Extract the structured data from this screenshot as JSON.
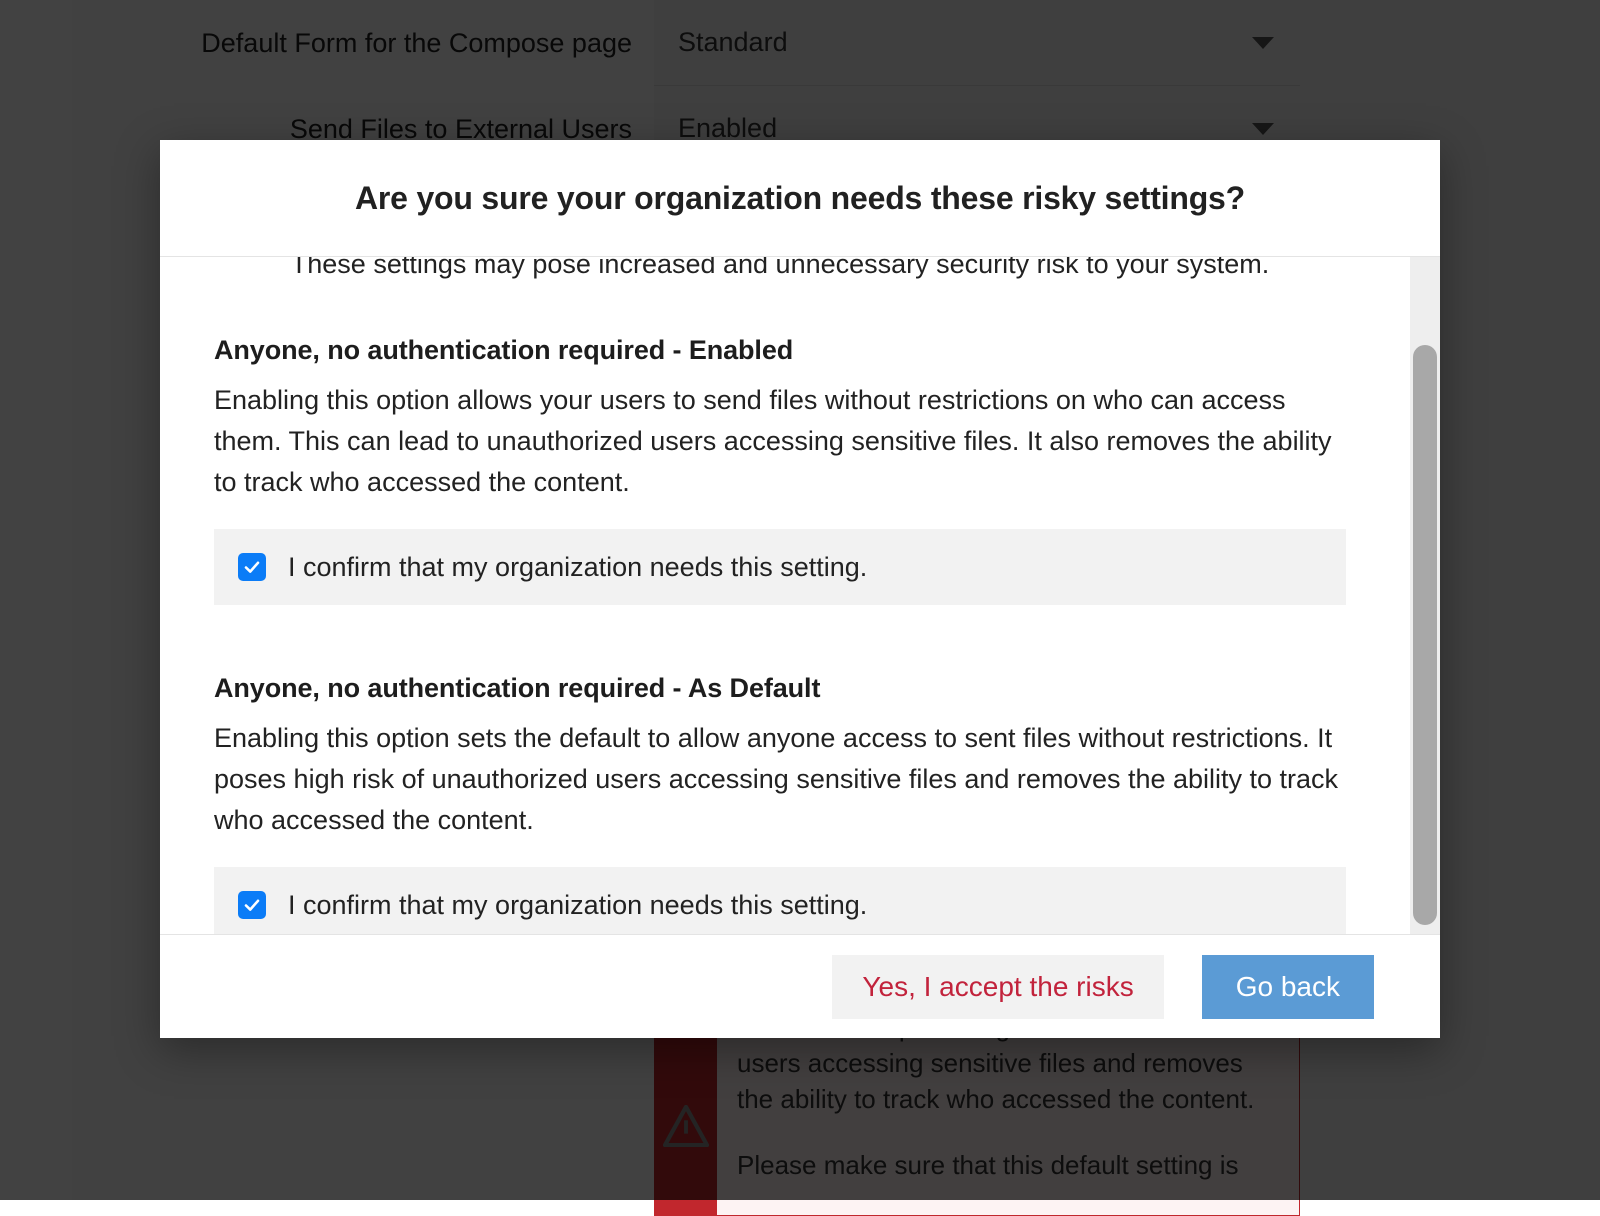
{
  "background": {
    "form_rows": [
      {
        "label": "Default Form for the Compose page",
        "value": "Standard",
        "caret": "chevron-down-icon"
      },
      {
        "label": "Send Files to External Users",
        "value": "Enabled",
        "caret": "chevron-down-icon"
      }
    ],
    "warning": {
      "icon": "warning-triangle-icon",
      "paragraph_1": "restrictions. It poses high risk of unauthorized users accessing sensitive files and removes the ability to track who accessed the content.",
      "paragraph_2": "Please make sure that this default setting is",
      "accent_color": "#c1272d"
    }
  },
  "dialog": {
    "title": "Are you sure your organization needs these risky settings?",
    "intro": "These settings may pose increased and unnecessary security risk to your system.",
    "risks": [
      {
        "heading": "Anyone, no authentication required - Enabled",
        "description": "Enabling this option allows your users to send files without restrictions on who can access them. This can lead to unauthorized users accessing sensitive files. It also removes the ability to track who accessed the content.",
        "confirm_label": "I confirm that my organization needs this setting.",
        "checked": true
      },
      {
        "heading": "Anyone, no authentication required - As Default",
        "description": "Enabling this option sets the default to allow anyone access to sent files without restrictions. It poses high risk of unauthorized users accessing sensitive files and removes the ability to track who accessed the content.",
        "confirm_label": "I confirm that my organization needs this setting.",
        "checked": true
      }
    ],
    "footer": {
      "accept_label": "Yes, I accept the risks",
      "goback_label": "Go back"
    },
    "colors": {
      "checkbox": "#0b7cf7",
      "accept_text": "#c2233c",
      "goback_background": "#5b9bd5",
      "confirm_row_background": "#f2f2f2"
    },
    "scrollbar": {
      "orientation": "vertical",
      "position_percent": 14
    }
  }
}
